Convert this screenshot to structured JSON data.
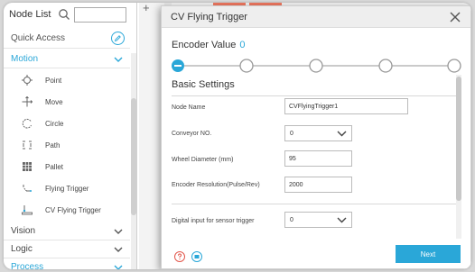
{
  "node_panel": {
    "title": "Node List",
    "search_value": "",
    "quick_access": "Quick Access",
    "categories": [
      {
        "label": "Motion"
      },
      {
        "label": "Vision"
      },
      {
        "label": "Logic"
      },
      {
        "label": "Process"
      }
    ],
    "items": [
      {
        "label": "Point",
        "icon": "point-icon"
      },
      {
        "label": "Move",
        "icon": "move-icon"
      },
      {
        "label": "Circle",
        "icon": "circle-icon"
      },
      {
        "label": "Path",
        "icon": "path-icon"
      },
      {
        "label": "Pallet",
        "icon": "pallet-icon"
      },
      {
        "label": "Flying Trigger",
        "icon": "flying-trigger-icon"
      },
      {
        "label": "CV Flying Trigger",
        "icon": "cv-flying-trigger-icon"
      }
    ]
  },
  "dialog": {
    "title": "CV Flying Trigger",
    "encoder_label": "Encoder Value",
    "encoder_value": "0",
    "step_count": 5,
    "current_step": 1,
    "section_title": "Basic Settings",
    "fields": {
      "node_name": {
        "label": "Node Name",
        "value": "CVFlyingTrigger1"
      },
      "conveyor": {
        "label": "Conveyor NO.",
        "value": "0"
      },
      "wheel": {
        "label": "Wheel Diameter (mm)",
        "value": "95"
      },
      "resolution": {
        "label": "Encoder Resolution(Pulse/Rev)",
        "value": "2000"
      },
      "digital_input": {
        "label": "Digital input for sensor trigger",
        "value": "0"
      }
    },
    "next_label": "Next"
  },
  "colors": {
    "accent": "#2aa7d8",
    "help_icon": "#e2574c"
  }
}
